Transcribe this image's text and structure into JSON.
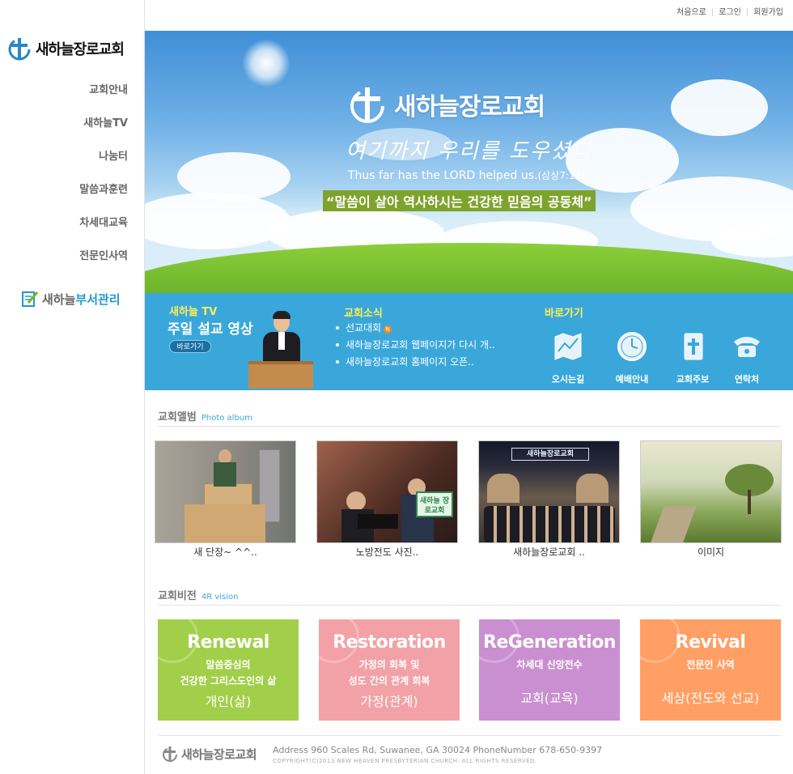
{
  "top_links": [
    "처음으로",
    "로그인",
    "회원가입"
  ],
  "sidebar": {
    "logo_text": "새하늘장로교회",
    "menu": [
      "교회안내",
      "새하늘TV",
      "나눔터",
      "말씀과훈련",
      "차세대교육",
      "전문인사역"
    ],
    "dept_a": "새하늘",
    "dept_b": "부서관리"
  },
  "hero": {
    "church_name": "새하늘장로교회",
    "handwritten": "여기까지 우리를 도우셨다",
    "english": "Thus far has the LORD helped us.",
    "reference": "(삼상7:12)",
    "slogan": "“말씀이 살아 역사하시는 건강한 믿음의 공동체”"
  },
  "tv": {
    "label": "새하늘 TV",
    "title": "주일 설교 영상",
    "button": "바로가기"
  },
  "news": {
    "label": "교회소식",
    "items": [
      "선교대회",
      "새하늘장로교회 웹페이지가 다시 개..",
      "새하늘장로교회 홈페이지 오픈.."
    ],
    "new_badge": "N"
  },
  "quick": {
    "label": "바로가기",
    "items": [
      {
        "label": "오시는길",
        "icon": "map-icon"
      },
      {
        "label": "예배안내",
        "icon": "clock-icon"
      },
      {
        "label": "교회주보",
        "icon": "bulletin-icon"
      },
      {
        "label": "연락처",
        "icon": "phone-icon"
      }
    ]
  },
  "album": {
    "title": "교회앨범",
    "subtitle": "Photo album",
    "photos": [
      {
        "caption": "새 단장~ ^^.."
      },
      {
        "caption": "노방전도 사진.."
      },
      {
        "caption": "새하늘장로교회 .."
      },
      {
        "caption": "이미지"
      }
    ],
    "sign_text": "새하늘 장로교회"
  },
  "vision": {
    "title": "교회비전",
    "subtitle": "4R vision",
    "cards": [
      {
        "title": "Renewal",
        "line1": "말씀중심의",
        "line2": "건강한 그리스도인의 삶",
        "line3": "개인(삶)",
        "color": "#a2cf4a"
      },
      {
        "title": "Restoration",
        "line1": "가정의 회복 및",
        "line2": "성도 간의 관계 회복",
        "line3": "가정(관계)",
        "color": "#f2a2a6"
      },
      {
        "title": "ReGeneration",
        "line1": "차세대 신앙전수",
        "line2": "",
        "line3": "교회(교육)",
        "color": "#c98fd0"
      },
      {
        "title": "Revival",
        "line1": "전문인 사역",
        "line2": "",
        "line3": "세상(전도와 선교)",
        "color": "#ff9f63"
      }
    ]
  },
  "footer": {
    "name": "새하늘장로교회",
    "address": "Address 960 Scales Rd, Suwanee, GA 30024 PhoneNumber 678-650-9397",
    "copyright": "COPYRIGHT(C)2013 NEW HEAVEN PRESBYTERIAN CHURCH. ALL RIGHTS RESERVED."
  }
}
